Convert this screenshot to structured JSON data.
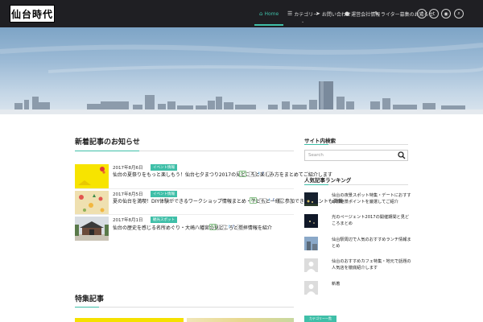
{
  "header": {
    "logo_text": "仙台時代",
    "nav": [
      {
        "label": "Home",
        "icon": "home-icon",
        "active": true
      },
      {
        "label": "カテゴリー",
        "icon": "list-icon",
        "has_dropdown": true
      },
      {
        "label": "お問い合わせ",
        "icon": "paper-plane-icon"
      },
      {
        "label": "運営会社情報",
        "icon": "globe-icon"
      },
      {
        "label": "ライター募集のお知らせ",
        "icon": "edit-icon"
      }
    ],
    "social": [
      {
        "icon": "facebook-icon",
        "glyph": "f"
      },
      {
        "icon": "twitter-icon",
        "glyph": "t"
      },
      {
        "icon": "rss-icon",
        "glyph": "◉"
      },
      {
        "icon": "search-icon",
        "glyph": "⌕"
      }
    ]
  },
  "main": {
    "recent_title": "新着記事のお知らせ",
    "posts": [
      {
        "date": "2017年8月6日",
        "category": "イベント情報",
        "title": "仙台の夏祭りをもっと楽しもう！仙台七夕まつり2017の見どころと楽しみ方をまとめてご紹介します",
        "share_count": "0"
      },
      {
        "date": "2017年8月5日",
        "category": "イベント情報",
        "title": "夏の仙台を満喫！DIY体験ができるワークショップ情報まとめ・子どもと一緒に参加できるイベントも満載",
        "share_count": "0"
      },
      {
        "date": "2017年8月1日",
        "category": "観光スポット",
        "title": "仙台の歴史を感じる名所めぐり・大崎八幡宮の見どころと参拝情報を紹介",
        "share_count": "0"
      }
    ],
    "second_title": "特集記事"
  },
  "sidebar": {
    "search_title": "サイト内検索",
    "search_placeholder": "Search",
    "popular_title": "人気記事ランキング",
    "popular": [
      {
        "text": "仙台の夜景スポット特集・デートにおすすめの絶景ポイントを厳選してご紹介"
      },
      {
        "text": "光のページェント2017の開催期間と見どころまとめ"
      },
      {
        "text": "仙台駅周辺で人気のおすすめランチ情報まとめ"
      },
      {
        "text": "仙台のおすすめカフェ特集・地元で話題の人気店を徹底紹介します"
      },
      {
        "text": "新着"
      }
    ],
    "button_label": "カテゴリー一覧"
  },
  "colors": {
    "accent": "#3fbfa8",
    "header_bg": "#1f1f23"
  }
}
